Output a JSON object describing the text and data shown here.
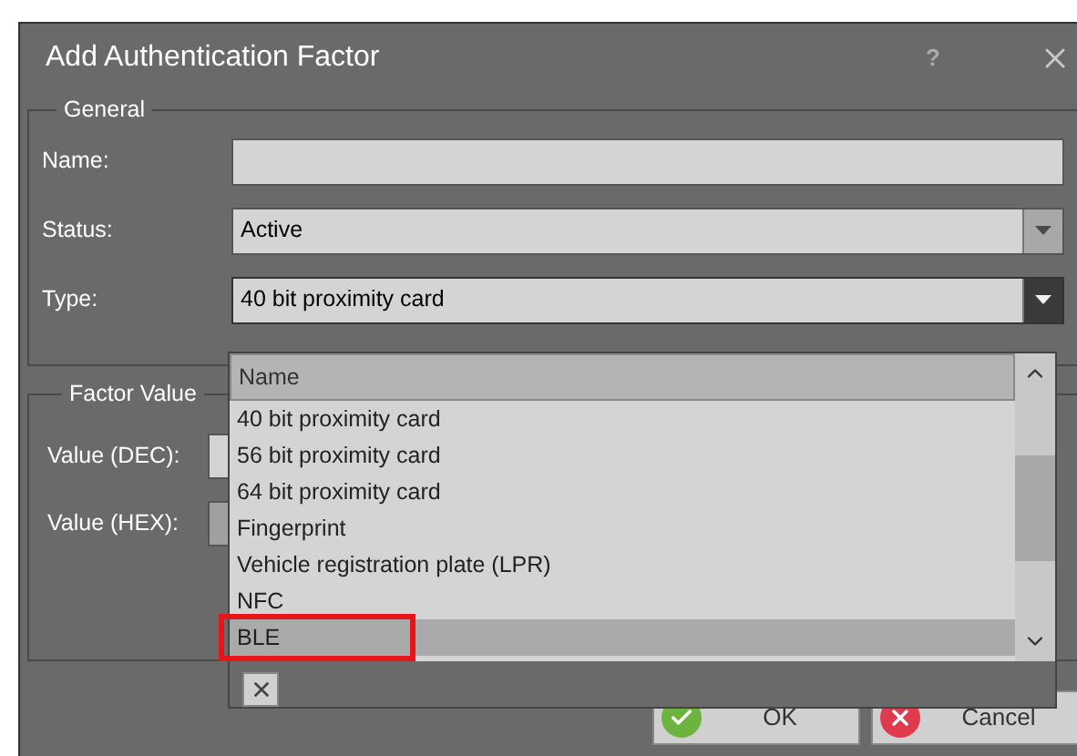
{
  "window": {
    "title": "Add Authentication Factor",
    "help": "?"
  },
  "general": {
    "legend": "General",
    "name": {
      "label": "Name:"
    },
    "status": {
      "label": "Status:",
      "value": "Active"
    },
    "type": {
      "label": "Type:",
      "value": "40 bit proximity card",
      "expanded": true
    }
  },
  "factor_value": {
    "legend": "Factor Value",
    "fields": [
      {
        "label": "Value (DEC):",
        "disabled": false
      },
      {
        "label": "Value (HEX):",
        "disabled": true
      }
    ]
  },
  "dropdown": {
    "column": "Name",
    "items": [
      {
        "label": "40 bit proximity card",
        "selected": false,
        "highlighted": false
      },
      {
        "label": "56 bit proximity card",
        "selected": false,
        "highlighted": false
      },
      {
        "label": "64 bit proximity card",
        "selected": false,
        "highlighted": false
      },
      {
        "label": "Fingerprint",
        "selected": false,
        "highlighted": false
      },
      {
        "label": "Vehicle registration plate (LPR)",
        "selected": false,
        "highlighted": false
      },
      {
        "label": "NFC",
        "selected": false,
        "highlighted": false
      },
      {
        "label": "BLE",
        "selected": true,
        "highlighted": true
      }
    ]
  },
  "buttons": [
    {
      "kind": "ok",
      "label": "OK"
    },
    {
      "kind": "cancel",
      "label": "Cancel"
    }
  ]
}
